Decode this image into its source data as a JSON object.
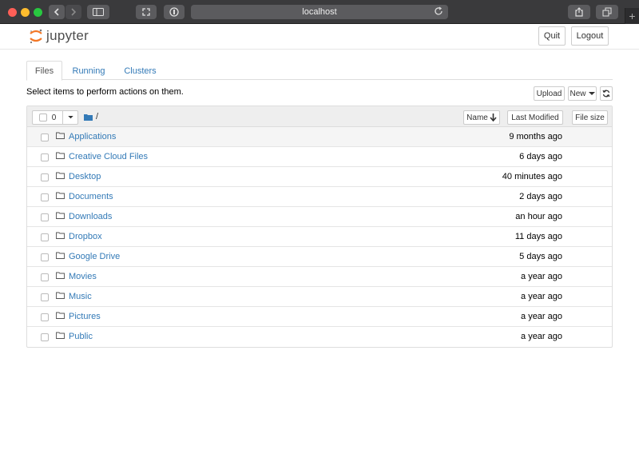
{
  "browser": {
    "url": "localhost"
  },
  "header": {
    "logo_text": "jupyter",
    "quit_label": "Quit",
    "logout_label": "Logout"
  },
  "tabs": [
    {
      "label": "Files",
      "active": true
    },
    {
      "label": "Running",
      "active": false
    },
    {
      "label": "Clusters",
      "active": false
    }
  ],
  "toolbar": {
    "instructions": "Select items to perform actions on them.",
    "upload_label": "Upload",
    "new_label": "New"
  },
  "list_header": {
    "selected_count": "0",
    "path": "/",
    "name_label": "Name",
    "last_modified_label": "Last Modified",
    "file_size_label": "File size"
  },
  "files": [
    {
      "name": "Applications",
      "modified": "9 months ago"
    },
    {
      "name": "Creative Cloud Files",
      "modified": "6 days ago"
    },
    {
      "name": "Desktop",
      "modified": "40 minutes ago"
    },
    {
      "name": "Documents",
      "modified": "2 days ago"
    },
    {
      "name": "Downloads",
      "modified": "an hour ago"
    },
    {
      "name": "Dropbox",
      "modified": "11 days ago"
    },
    {
      "name": "Google Drive",
      "modified": "5 days ago"
    },
    {
      "name": "Movies",
      "modified": "a year ago"
    },
    {
      "name": "Music",
      "modified": "a year ago"
    },
    {
      "name": "Pictures",
      "modified": "a year ago"
    },
    {
      "name": "Public",
      "modified": "a year ago"
    }
  ],
  "colors": {
    "link": "#337ab7",
    "jupyter_orange": "#f37726"
  }
}
